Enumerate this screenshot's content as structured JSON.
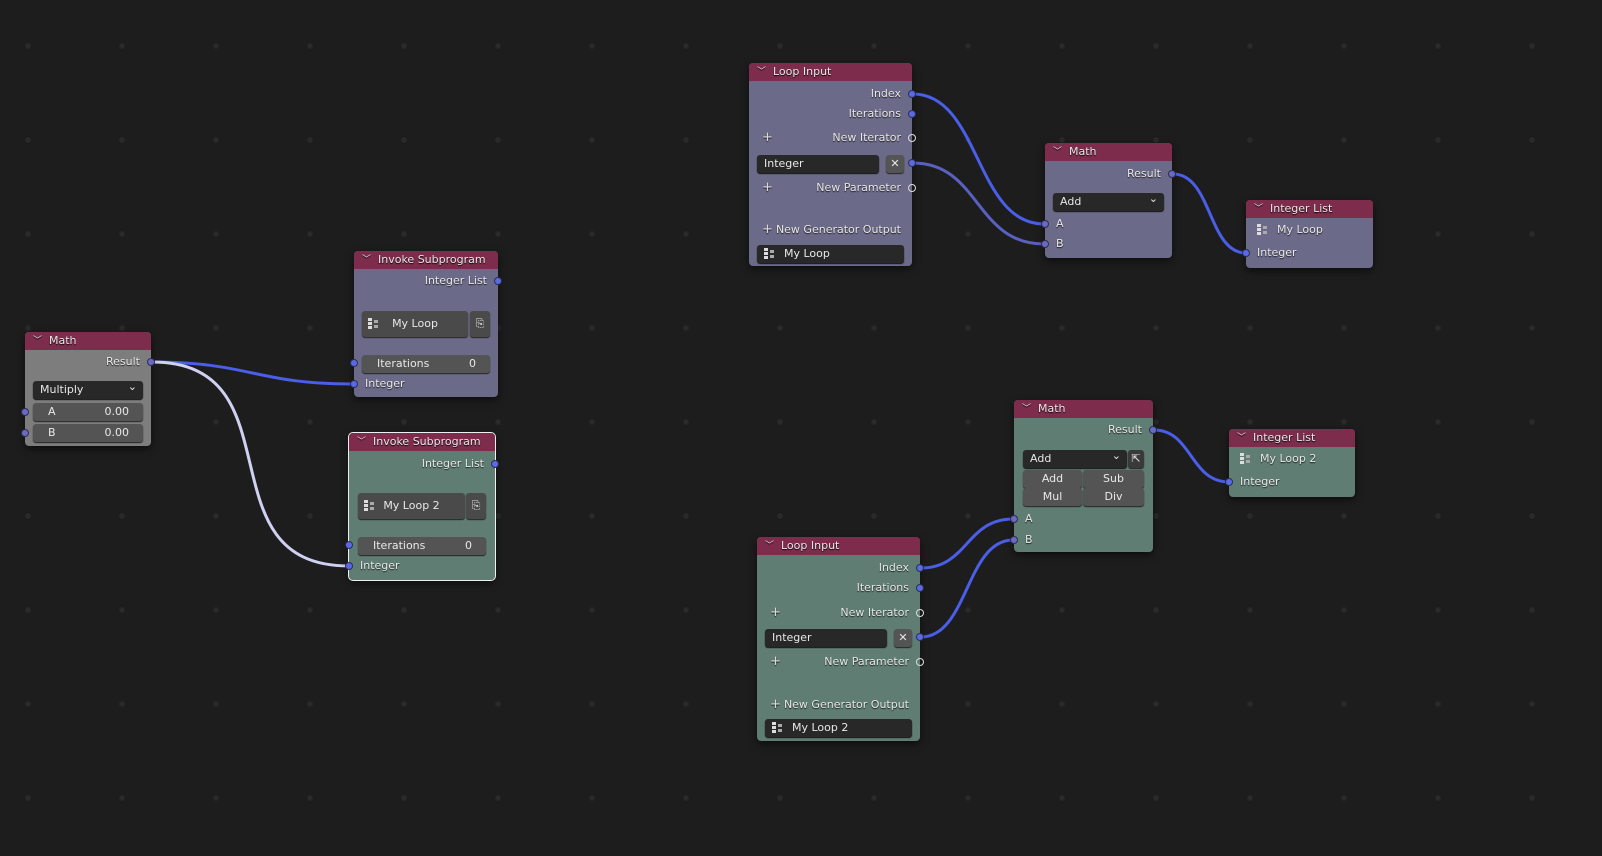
{
  "colors": {
    "header": "#7d2d4b",
    "purple_node": "#6b6a88",
    "teal_node": "#5f7d72",
    "gray_node": "#7d7d7d",
    "link": "#4a5ee8",
    "selected_link": "#d0d0f2",
    "background": "#1d1d1d"
  },
  "math_multiply": {
    "title": "Math",
    "output": "Result",
    "operation": "Multiply",
    "a_label": "A",
    "a_value": "0.00",
    "b_label": "B",
    "b_value": "0.00"
  },
  "invoke1": {
    "title": "Invoke Subprogram",
    "output": "Integer List",
    "program": "My Loop",
    "iter_label": "Iterations",
    "iter_value": "0",
    "input": "Integer"
  },
  "invoke2": {
    "title": "Invoke Subprogram",
    "output": "Integer List",
    "program": "My Loop 2",
    "iter_label": "Iterations",
    "iter_value": "0",
    "input": "Integer"
  },
  "loop1": {
    "title": "Loop Input",
    "index": "Index",
    "iterations": "Iterations",
    "new_iterator": "New Iterator",
    "param_name": "Integer",
    "new_parameter": "New Parameter",
    "new_generator": "New Generator Output",
    "loop_name": "My Loop"
  },
  "math_add1": {
    "title": "Math",
    "output": "Result",
    "operation": "Add",
    "a_label": "A",
    "b_label": "B"
  },
  "intlist1": {
    "title": "Integer List",
    "loop": "My Loop",
    "input": "Integer"
  },
  "math_add2": {
    "title": "Math",
    "output": "Result",
    "operation": "Add",
    "quick_ops": [
      "Add",
      "Sub",
      "Mul",
      "Div"
    ],
    "a_label": "A",
    "b_label": "B"
  },
  "intlist2": {
    "title": "Integer List",
    "loop": "My Loop 2",
    "input": "Integer"
  },
  "loop2": {
    "title": "Loop Input",
    "index": "Index",
    "iterations": "Iterations",
    "new_iterator": "New Iterator",
    "param_name": "Integer",
    "new_parameter": "New Parameter",
    "new_generator": "New Generator Output",
    "loop_name": "My Loop 2"
  }
}
